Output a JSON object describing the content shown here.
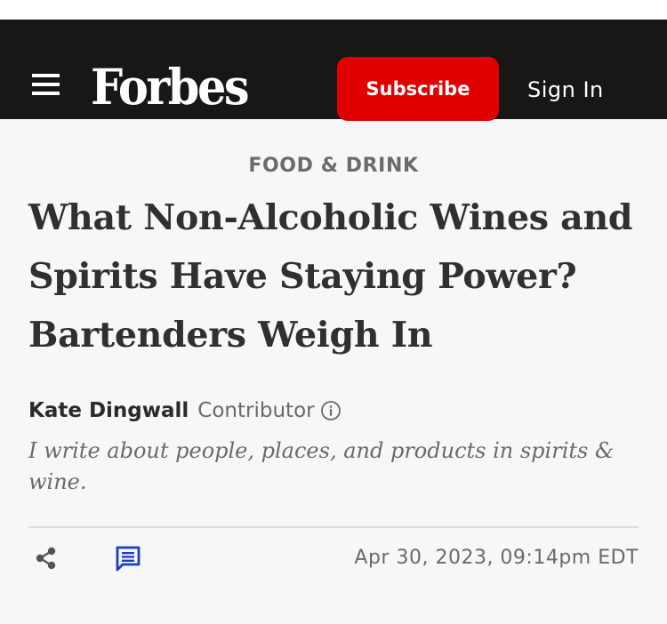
{
  "header": {
    "logo_text": "Forbes",
    "subscribe_label": "Subscribe",
    "signin_label": "Sign In",
    "menu_icon": "hamburger-menu-icon",
    "background_color": "#181716",
    "subscribe_color": "#e00000"
  },
  "article": {
    "channel": "FOOD & DRINK",
    "headline": "What Non-Alcoholic Wines and Spirits Have Staying Power? Bartenders Weigh In",
    "author": {
      "name": "Kate Dingwall",
      "role": "Contributor",
      "info_icon": "info-circle-icon",
      "bio": "I write about people, places, and products in spirits & wine."
    },
    "meta": {
      "share_icon": "share-icon",
      "comment_icon": "comment-icon",
      "comment_icon_color": "#1a3fc1",
      "date": "Apr 30, 2023, 09:14pm EDT"
    }
  }
}
